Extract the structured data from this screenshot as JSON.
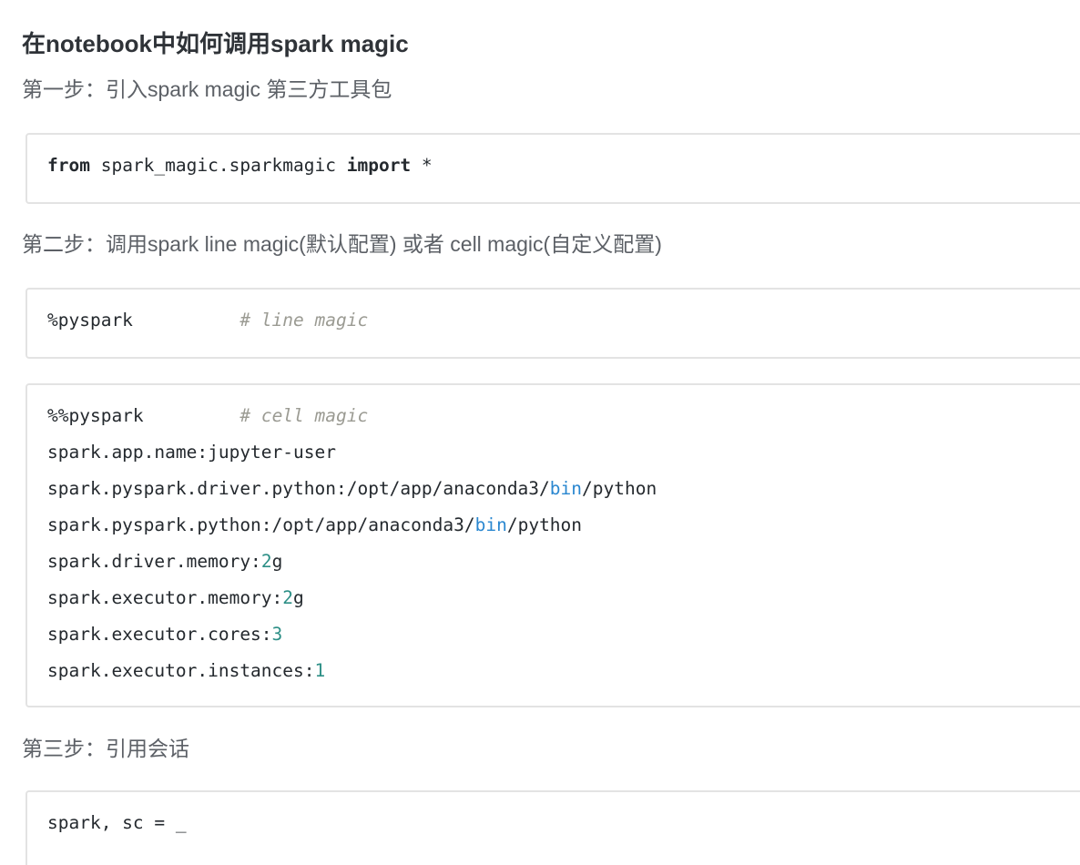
{
  "document": {
    "title": "在notebook中如何调用spark magic",
    "title_color": "#2f3338",
    "heading_color": "#5c6066",
    "code_border_color": "#e3e3e3",
    "code_background": "#ffffff"
  },
  "steps": [
    {
      "heading": "第一步：引入spark magic 第三方工具包"
    },
    {
      "heading": "第二步：调用spark line magic(默认配置) 或者 cell magic(自定义配置)"
    },
    {
      "heading": "第三步：引用会话"
    }
  ],
  "code_blocks": [
    {
      "id": "import-block",
      "language": "python",
      "lines": [
        {
          "tokens": [
            {
              "text": "from",
              "kind": "keyword"
            },
            {
              "text": " spark_magic.sparkmagic ",
              "kind": "plain"
            },
            {
              "text": "import",
              "kind": "keyword"
            },
            {
              "text": " *",
              "kind": "plain"
            }
          ]
        }
      ]
    },
    {
      "id": "line-magic-block",
      "language": "python",
      "lines": [
        {
          "tokens": [
            {
              "text": "%pyspark",
              "kind": "plain"
            },
            {
              "text": "          ",
              "kind": "plain"
            },
            {
              "text": "# line magic",
              "kind": "comment"
            }
          ]
        }
      ]
    },
    {
      "id": "cell-magic-block",
      "language": "python",
      "lines": [
        {
          "tokens": [
            {
              "text": "%%pyspark",
              "kind": "plain"
            },
            {
              "text": "         ",
              "kind": "plain"
            },
            {
              "text": "# cell magic",
              "kind": "comment"
            }
          ]
        },
        {
          "tokens": [
            {
              "text": "spark.app.name:jupyter-user",
              "kind": "plain"
            }
          ]
        },
        {
          "tokens": [
            {
              "text": "spark.pyspark.driver.python:/opt/app/anaconda3/",
              "kind": "plain"
            },
            {
              "text": "bin",
              "kind": "blue"
            },
            {
              "text": "/python",
              "kind": "plain"
            }
          ]
        },
        {
          "tokens": [
            {
              "text": "spark.pyspark.python:/opt/app/anaconda3/",
              "kind": "plain"
            },
            {
              "text": "bin",
              "kind": "blue"
            },
            {
              "text": "/python",
              "kind": "plain"
            }
          ]
        },
        {
          "tokens": [
            {
              "text": "spark.driver.memory:",
              "kind": "plain"
            },
            {
              "text": "2",
              "kind": "number"
            },
            {
              "text": "g",
              "kind": "plain"
            }
          ]
        },
        {
          "tokens": [
            {
              "text": "spark.executor.memory:",
              "kind": "plain"
            },
            {
              "text": "2",
              "kind": "number"
            },
            {
              "text": "g",
              "kind": "plain"
            }
          ]
        },
        {
          "tokens": [
            {
              "text": "spark.executor.cores:",
              "kind": "plain"
            },
            {
              "text": "3",
              "kind": "number"
            }
          ]
        },
        {
          "tokens": [
            {
              "text": "spark.executor.instances:",
              "kind": "plain"
            },
            {
              "text": "1",
              "kind": "number"
            }
          ]
        }
      ]
    },
    {
      "id": "session-block",
      "language": "python",
      "lines": [
        {
          "tokens": [
            {
              "text": "spark, sc = _",
              "kind": "plain"
            }
          ]
        }
      ]
    }
  ],
  "syntax_colors": {
    "keyword": "#24292e",
    "comment": "#9b9b93",
    "blue": "#2a87d0",
    "number": "#2d8f86",
    "plain": "#24292e"
  }
}
